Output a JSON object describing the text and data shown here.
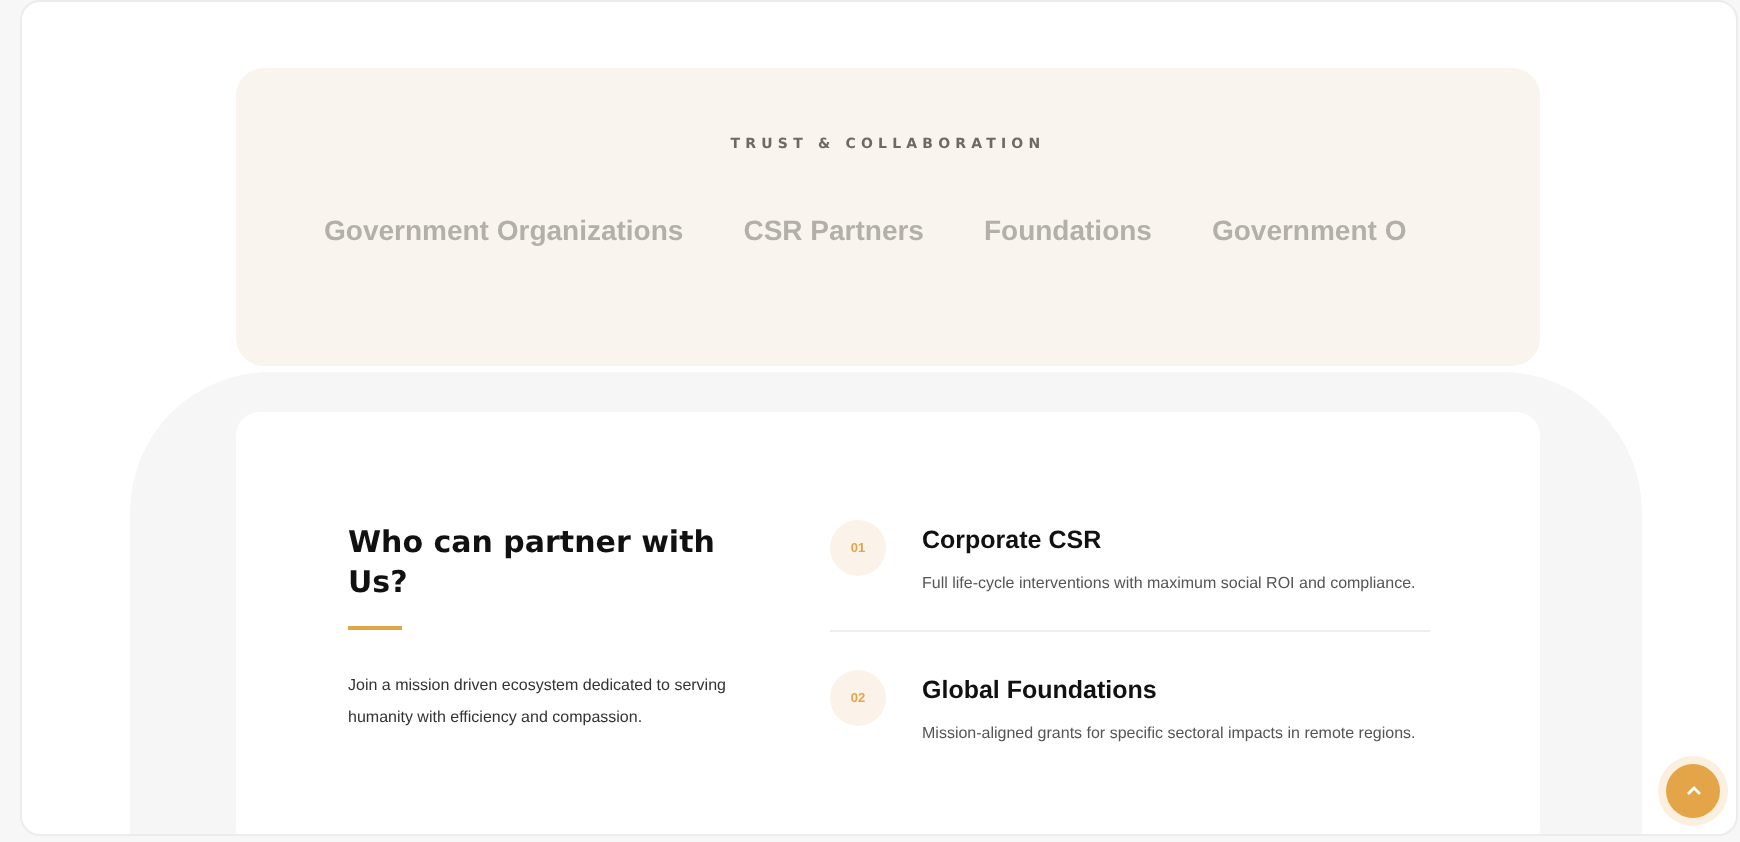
{
  "trust_band": {
    "eyebrow": "TRUST & COLLABORATION",
    "partners": [
      "Government Organizations",
      "CSR Partners",
      "Foundations",
      "Government O"
    ]
  },
  "partner_section": {
    "heading": "Who can partner with Us?",
    "description": "Join a mission driven ecosystem dedicated to serving humanity with efficiency and compassion.",
    "items": [
      {
        "number": "01",
        "title": "Corporate CSR",
        "text": "Full life-cycle interventions with maximum social ROI and compliance."
      },
      {
        "number": "02",
        "title": "Global Foundations",
        "text": "Mission-aligned grants for specific sectoral impacts in remote regions."
      }
    ]
  }
}
